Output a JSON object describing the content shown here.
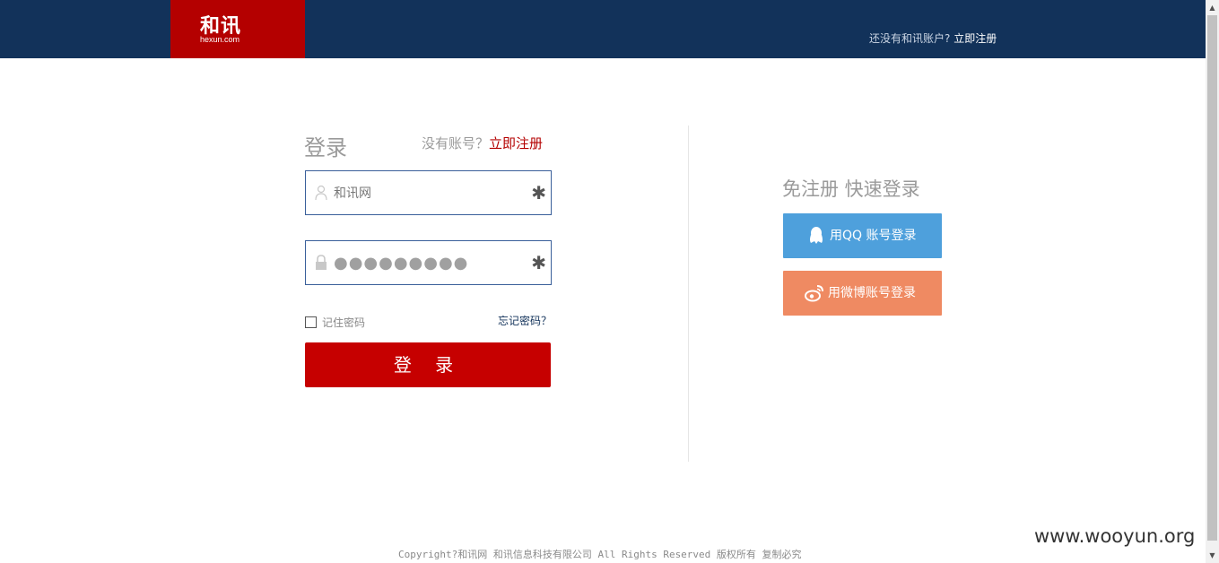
{
  "header": {
    "logo_text": "和讯",
    "logo_subtext": "hexun.com",
    "no_account_prompt": "还没有和讯账户?",
    "register_link": "立即注册"
  },
  "login": {
    "title": "登录",
    "no_account": "没有账号？",
    "register_link": "立即注册",
    "username_value": "和讯网",
    "password_value": "●●●●●●●●●",
    "required_mark": "✱",
    "remember_label": "记住密码",
    "forgot_link": "忘记密码？",
    "submit_label": "登 录"
  },
  "quick_login": {
    "title": "免注册 快速登录",
    "qq_button": "用QQ 账号登录",
    "weibo_button": "用微博账号登录"
  },
  "footer": {
    "copyright": "Copyright?和讯网 和讯信息科技有限公司 All Rights Reserved 版权所有 复制必究"
  },
  "watermark": "www.wooyun.org",
  "colors": {
    "header_bg": "#12325a",
    "logo_bg": "#b40000",
    "login_button": "#c60000",
    "qq_button": "#4ea0dc",
    "weibo_button": "#ef8a62",
    "field_border": "#3a5f9a"
  },
  "icons": {
    "username": "user-icon",
    "password": "lock-icon",
    "qq": "qq-icon",
    "weibo": "weibo-icon"
  }
}
